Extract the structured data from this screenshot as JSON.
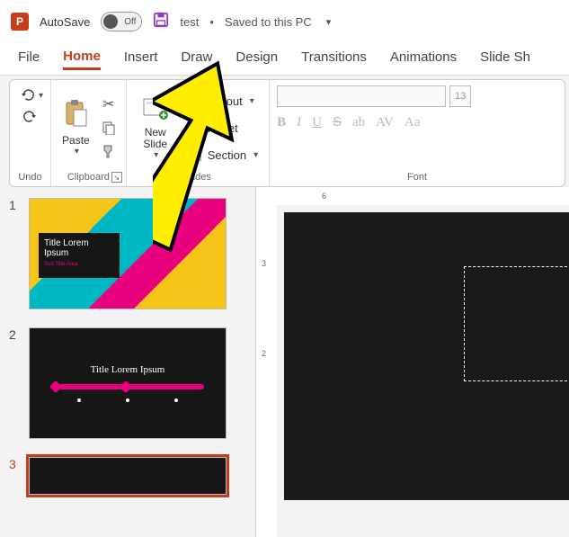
{
  "titlebar": {
    "autosave_label": "AutoSave",
    "toggle_state": "Off",
    "doc_name": "test",
    "save_status": "Saved to this PC"
  },
  "tabs": [
    "File",
    "Home",
    "Insert",
    "Draw",
    "Design",
    "Transitions",
    "Animations",
    "Slide Sh"
  ],
  "active_tab": "Home",
  "ribbon": {
    "undo_group": "Undo",
    "clipboard_group": "Clipboard",
    "paste_label": "Paste",
    "slides_group": "Slides",
    "new_slide_label": "New Slide",
    "layout_label": "Layout",
    "reset_label": "Reset",
    "section_label": "Section",
    "font_group": "Font",
    "font_size": "13"
  },
  "thumbnails": [
    {
      "num": "1",
      "title": "Title Lorem Ipsum",
      "subtitle": "Sub Title Area"
    },
    {
      "num": "2",
      "title": "Title Lorem Ipsum"
    },
    {
      "num": "3"
    }
  ],
  "ruler": {
    "h_label": "6",
    "v_labels": [
      "3",
      "2"
    ]
  }
}
